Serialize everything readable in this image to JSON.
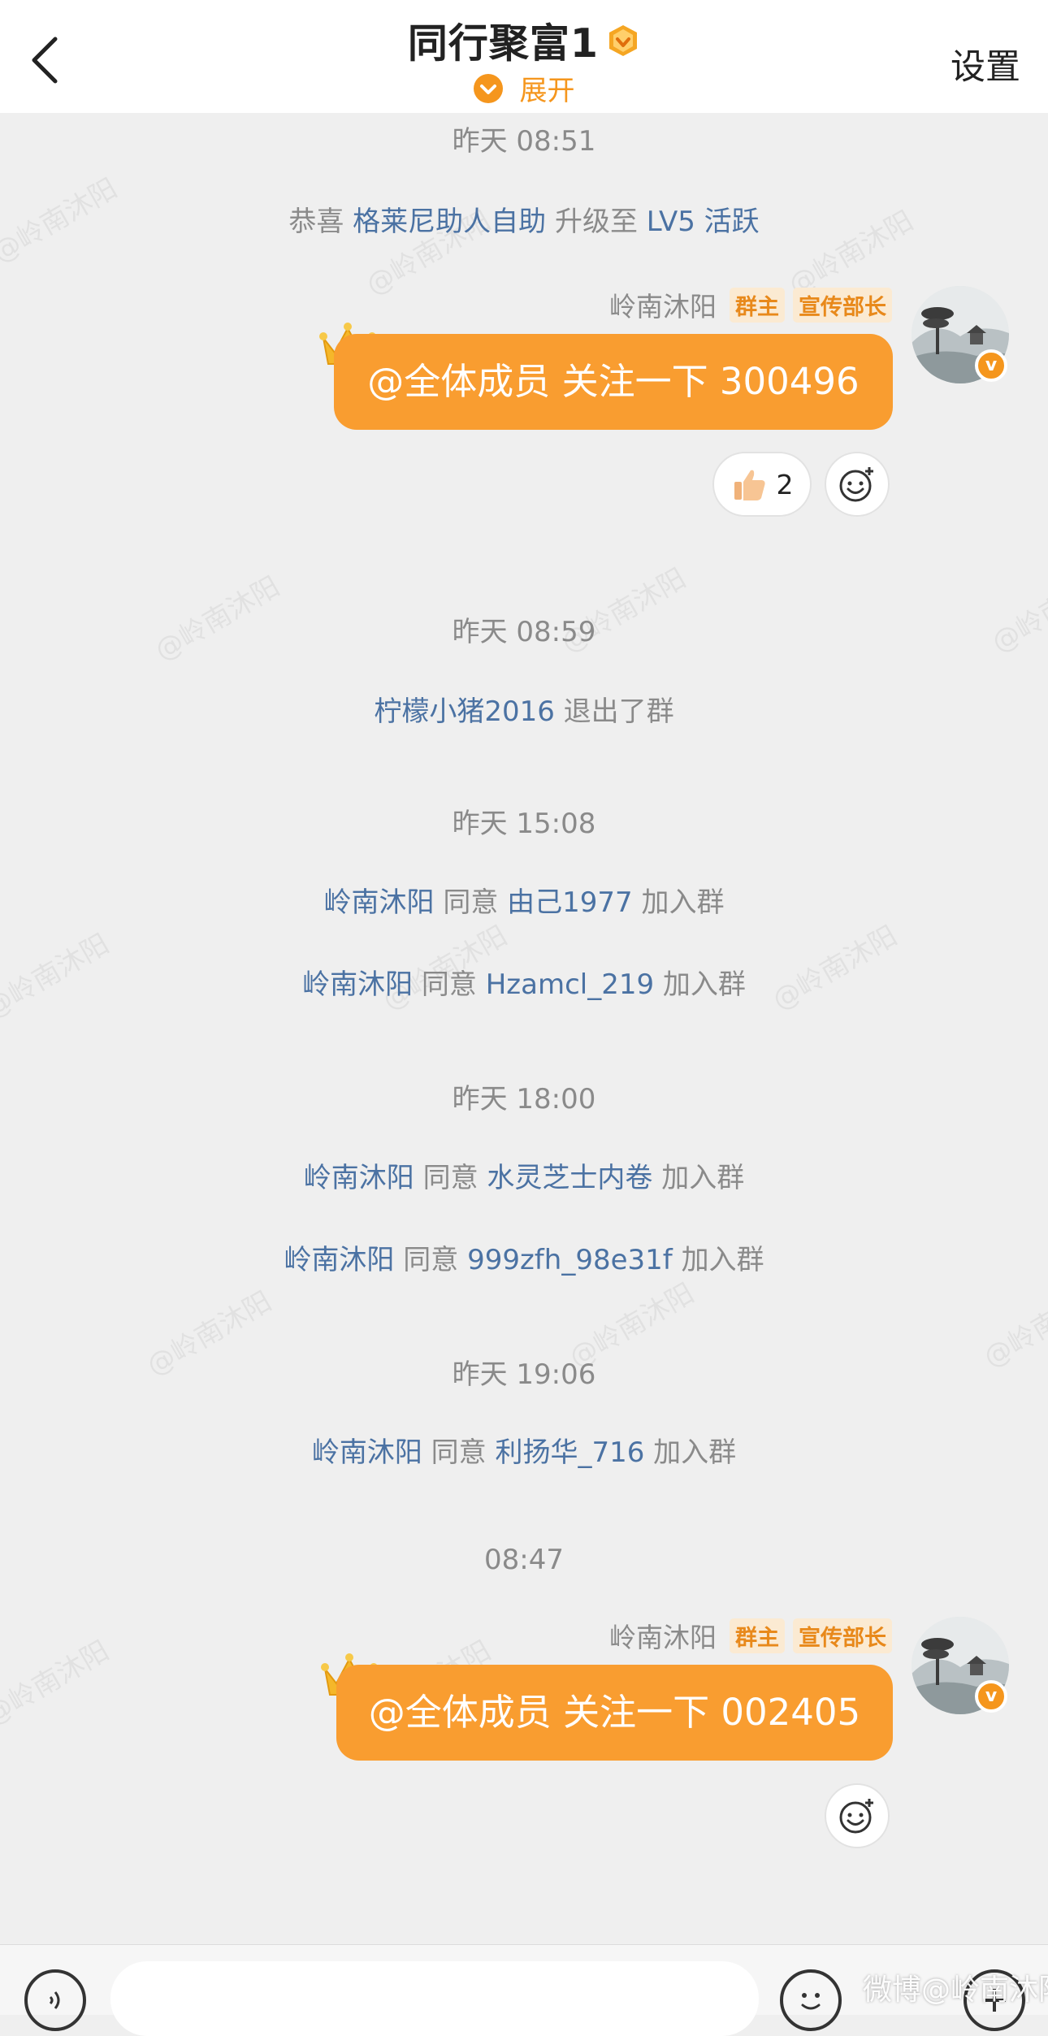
{
  "header": {
    "title": "同行聚富1",
    "expand_label": "展开",
    "settings_label": "设置"
  },
  "watermark_text": "@岭南沐阳",
  "feed": {
    "ts1": "昨天 08:51",
    "sys1": {
      "prefix": "恭喜",
      "user": "格莱尼助人自助",
      "middle": "升级至",
      "level": "LV5 活跃"
    },
    "msg1": {
      "sender": "岭南沐阳",
      "tag_owner": "群主",
      "tag_role": "宣传部长",
      "text": "@全体成员 关注一下 300496",
      "reaction_count": "2"
    },
    "ts2": "昨天 08:59",
    "sys2": {
      "user": "柠檬小猪2016",
      "action": "退出了群"
    },
    "ts3": "昨天 15:08",
    "sys3": {
      "admin": "岭南沐阳",
      "agree": "同意",
      "user": "由己1977",
      "action": "加入群"
    },
    "sys4": {
      "admin": "岭南沐阳",
      "agree": "同意",
      "user": "Hzamcl_219",
      "action": "加入群"
    },
    "ts4": "昨天 18:00",
    "sys5": {
      "admin": "岭南沐阳",
      "agree": "同意",
      "user": "水灵芝士内卷",
      "action": "加入群"
    },
    "sys6": {
      "admin": "岭南沐阳",
      "agree": "同意",
      "user": "999zfh_98e31f",
      "action": "加入群"
    },
    "ts5": "昨天 19:06",
    "sys7": {
      "admin": "岭南沐阳",
      "agree": "同意",
      "user": "利扬华_716",
      "action": "加入群"
    },
    "ts6": "08:47",
    "msg2": {
      "sender": "岭南沐阳",
      "tag_owner": "群主",
      "tag_role": "宣传部长",
      "text": "@全体成员 关注一下 002405"
    }
  },
  "input": {
    "placeholder": ""
  },
  "footer_watermark": "微博@岭南沐阳",
  "colors": {
    "accent": "#f99d30",
    "link": "#4b72a3",
    "background": "#efefef"
  }
}
